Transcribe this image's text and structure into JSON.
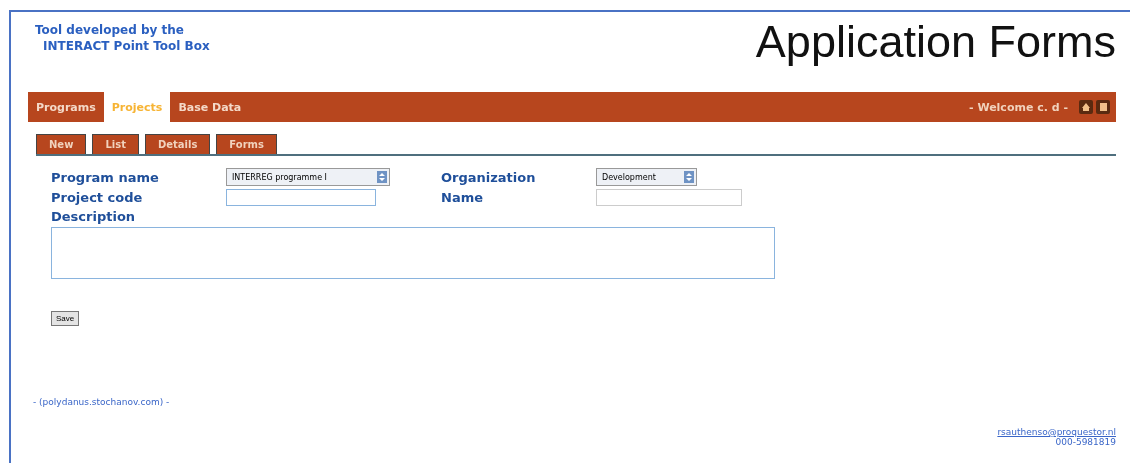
{
  "header": {
    "credit_line_1": "Tool developed by the",
    "credit_line_2": "INTERACT Point Tool Box",
    "title": "Application Forms"
  },
  "main_tabs": [
    {
      "label": "Programs",
      "selected": false
    },
    {
      "label": "Projects",
      "selected": true
    },
    {
      "label": "Base Data",
      "selected": false
    }
  ],
  "welcome": "- Welcome c. d -",
  "sub_tabs": [
    {
      "label": "New"
    },
    {
      "label": "List"
    },
    {
      "label": "Details"
    },
    {
      "label": "Forms"
    }
  ],
  "form": {
    "program_name": {
      "label": "Program name",
      "value": "INTERREG programme I"
    },
    "organization": {
      "label": "Organization",
      "value": "Development"
    },
    "project_code": {
      "label": "Project code"
    },
    "name": {
      "label": "Name"
    },
    "description": {
      "label": "Description"
    },
    "save_button": "Save"
  },
  "footer": {
    "left_link": "- (polydanus.stochanov.com) -",
    "email": "rsauthenso@proquestor.nl",
    "phone": "000-5981819"
  }
}
